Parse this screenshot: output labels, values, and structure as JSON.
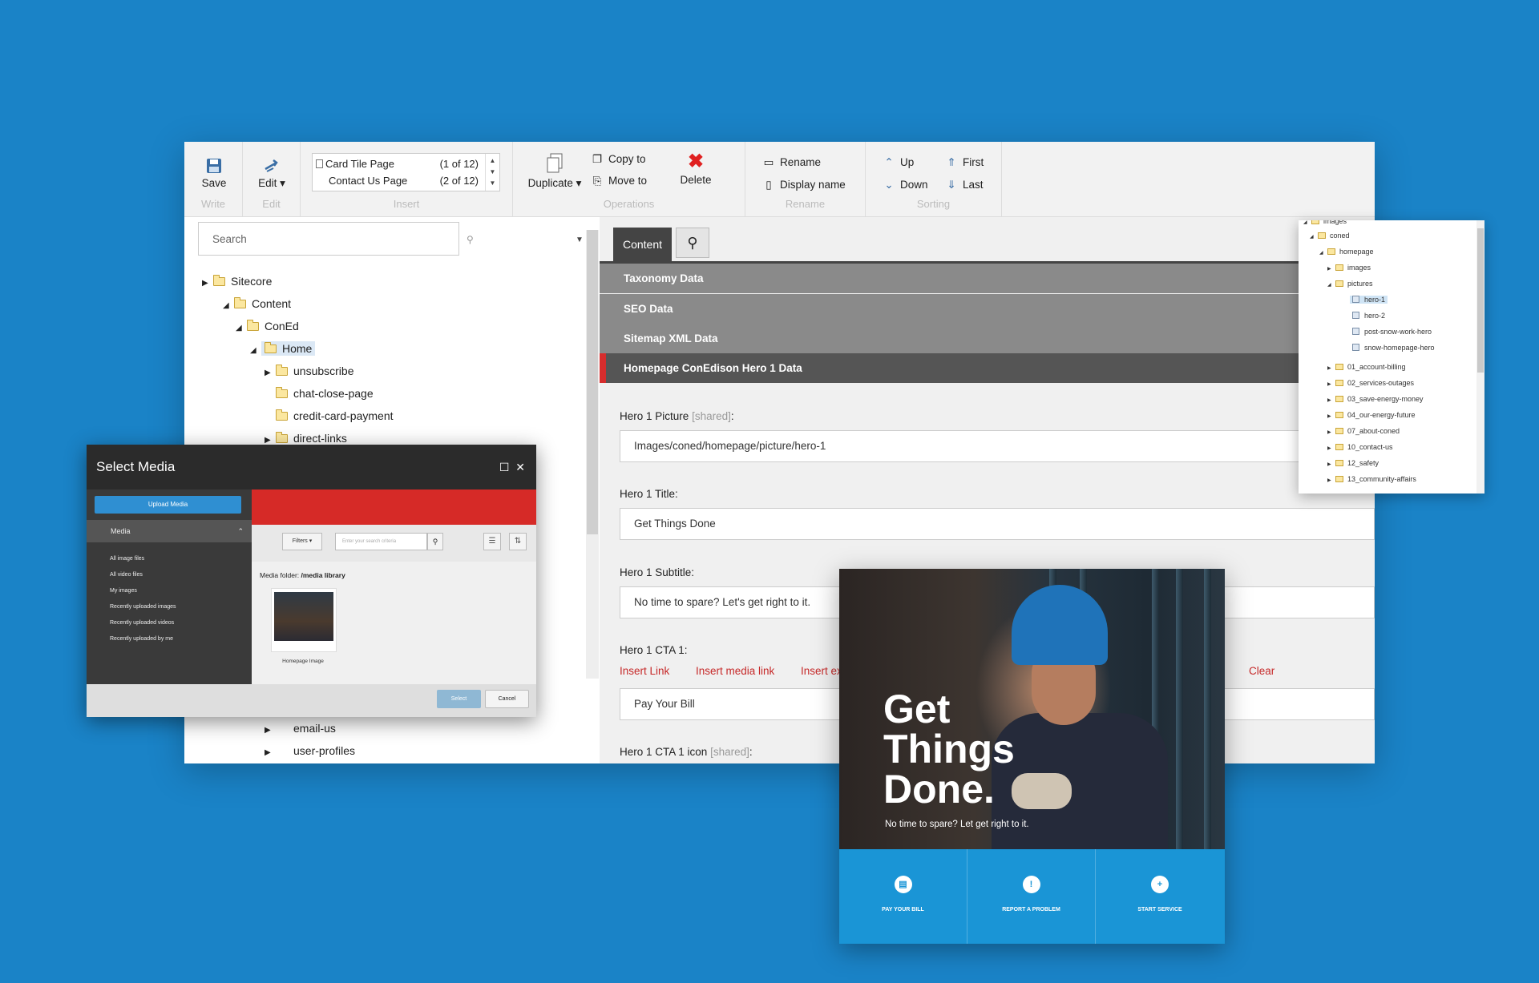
{
  "ribbon": {
    "save": "Save",
    "write": "Write",
    "edit": "Edit ▾",
    "edit_group": "Edit",
    "insert_items": [
      {
        "label": "Card Tile Page",
        "count": "(1 of 12)"
      },
      {
        "label": "Contact Us Page",
        "count": "(2 of 12)"
      }
    ],
    "insert_group": "Insert",
    "duplicate": "Duplicate ▾",
    "copy_to": "Copy to",
    "move_to": "Move to",
    "delete": "Delete",
    "operations_group": "Operations",
    "rename": "Rename",
    "display_name": "Display name",
    "rename_group": "Rename",
    "up": "Up",
    "down": "Down",
    "first": "First",
    "last": "Last",
    "sorting_group": "Sorting"
  },
  "tree": {
    "search_placeholder": "Search",
    "nodes": [
      "Sitecore",
      "Content",
      "ConEd",
      "Home",
      "unsubscribe",
      "chat-close-page",
      "credit-card-payment",
      "direct-links",
      "email-us",
      "user-profiles"
    ]
  },
  "content": {
    "tab_content": "Content",
    "sections": [
      "Taxonomy Data",
      "SEO Data",
      "Sitemap XML Data",
      "Homepage ConEdison Hero 1 Data"
    ],
    "fields": {
      "hero1_picture_label": "Hero 1 Picture",
      "shared": "[shared]",
      "hero1_picture_value": "Images/coned/homepage/picture/hero-1",
      "hero1_title_label": "Hero 1 Title:",
      "hero1_title_value": "Get Things Done",
      "hero1_subtitle_label": "Hero 1 Subtitle:",
      "hero1_subtitle_value": "No time to spare? Let's get right to it.",
      "hero1_cta_label": "Hero 1 CTA 1:",
      "hero1_cta_value": "Pay Your Bill",
      "hero1_cta_icon_label": "Hero 1 CTA 1 icon"
    },
    "links": {
      "insert_link": "Insert Link",
      "insert_media_link": "Insert media link",
      "insert_ex": "Insert ex",
      "clear": "Clear"
    }
  },
  "dialog": {
    "title": "Select Media",
    "upload": "Upload Media",
    "media": "Media",
    "links": [
      "All image files",
      "All video files",
      "My images",
      "Recently uploaded images",
      "Recently uploaded videos",
      "Recently uploaded by me"
    ],
    "filters": "Filters",
    "search_placeholder": "Enter your search criteria",
    "folder_label": "Media folder:",
    "folder_value": "/media library",
    "thumb_caption": "Homepage Image",
    "select": "Select",
    "cancel": "Cancel"
  },
  "media_tree": {
    "top": "images",
    "coned": "coned",
    "homepage": "homepage",
    "images": "images",
    "pictures": "pictures",
    "items": [
      "hero-1",
      "hero-2",
      "post-snow-work-hero",
      "snow-homepage-hero"
    ],
    "folders": [
      "01_account-billing",
      "02_services-outages",
      "03_save-energy-money",
      "04_our-energy-future",
      "07_about-coned",
      "10_contact-us",
      "12_safety",
      "13_community-affairs"
    ]
  },
  "hero": {
    "title_lines": [
      "Get",
      "Things",
      "Done."
    ],
    "subtitle": "No time to spare? Let get right to it.",
    "buttons": [
      "PAY YOUR BILL",
      "REPORT A PROBLEM",
      "START SERVICE"
    ]
  },
  "colors": {
    "background": "#1a83c7",
    "accent_red": "#d62d2d",
    "hero_blue": "#1a95d6"
  }
}
